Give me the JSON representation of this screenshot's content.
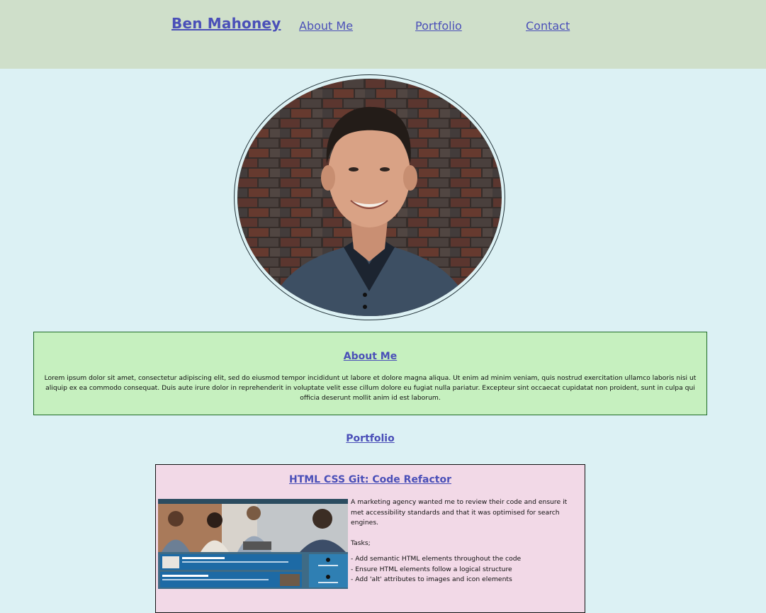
{
  "header": {
    "brand": "Ben Mahoney",
    "nav": [
      {
        "label": "About Me"
      },
      {
        "label": "Portfolio"
      },
      {
        "label": "Contact"
      }
    ]
  },
  "about": {
    "title": "About Me",
    "text": "Lorem ipsum dolor sit amet, consectetur adipiscing elit, sed do eiusmod tempor incididunt ut labore et dolore magna aliqua. Ut enim ad minim veniam, quis nostrud exercitation ullamco laboris nisi ut aliquip ex ea commodo consequat. Duis aute irure dolor in reprehenderit in voluptate velit esse cillum dolore eu fugiat nulla pariatur. Excepteur sint occaecat cupidatat non proident, sunt in culpa qui officia deserunt mollit anim id est laborum."
  },
  "portfolio": {
    "heading": "Portfolio",
    "projects": [
      {
        "title": "HTML CSS Git: Code Refactor",
        "description": "A marketing agency wanted me to review their code and ensure it met accessibility standards and that it was optimised for search engines.",
        "tasks_label": "Tasks;",
        "tasks": [
          "- Add semantic HTML elements throughout the code",
          "- Ensure HTML elements follow a logical structure",
          "- Add 'alt' attributes to images and icon elements"
        ]
      }
    ]
  },
  "colors": {
    "page_background": "#dcf1f4",
    "header_background": "#cfdfca",
    "about_background": "#c6f0bf",
    "card_background": "#f2d9e7",
    "link": "#4a4fb8"
  }
}
